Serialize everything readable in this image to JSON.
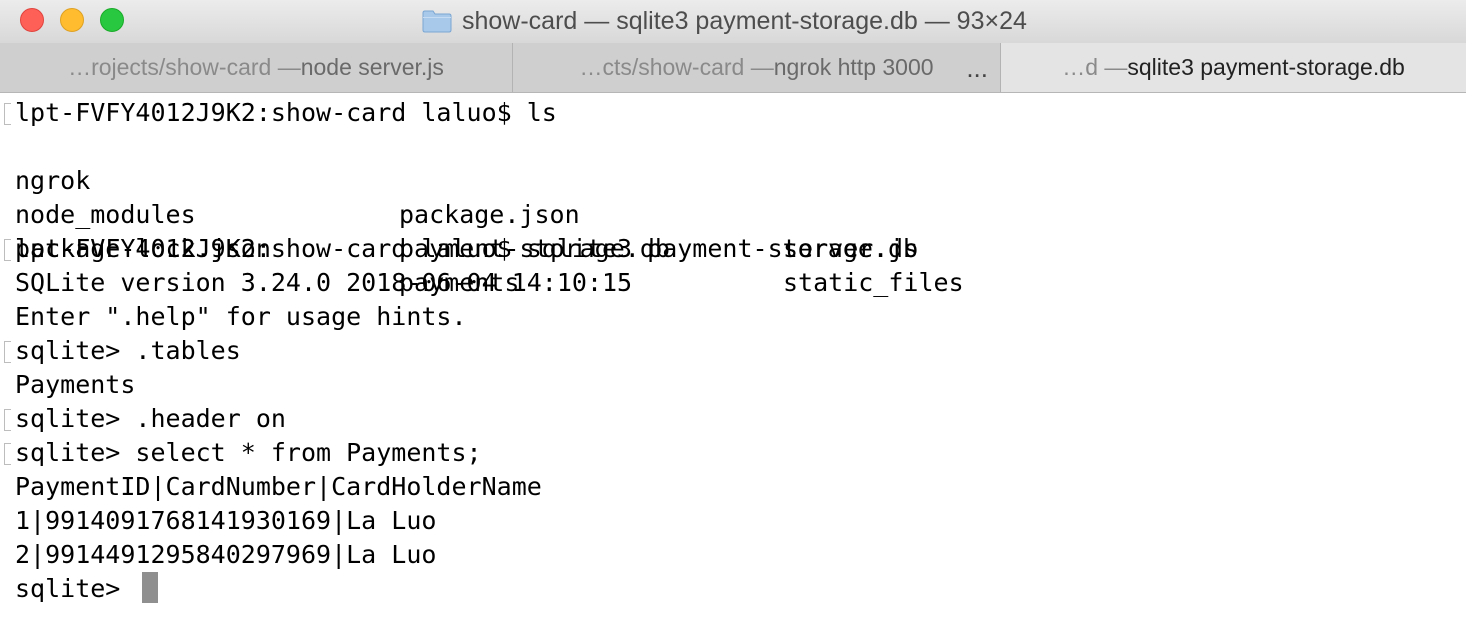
{
  "window": {
    "title": "show-card — sqlite3 payment-storage.db — 93×24"
  },
  "tabs": [
    {
      "prefix": "…rojects/show-card — ",
      "main": "node server.js"
    },
    {
      "prefix": "…cts/show-card — ",
      "main": "ngrok http 3000",
      "overflow": "..."
    },
    {
      "prefix": "…d — ",
      "main": "sqlite3 payment-storage.db"
    }
  ],
  "terminal": {
    "lines": [
      "lpt-FVFY4012J9K2:show-card laluo$ ls",
      "SQLite version 3.24.0 2018-06-04 14:10:15",
      "Enter \".help\" for usage hints.",
      "sqlite> .tables",
      "Payments",
      "sqlite> .header on",
      "sqlite> select * from Payments;",
      "PaymentID|CardNumber|CardHolderName",
      "1|9914091768141930169|La Luo",
      "2|9914491295840297969|La Luo",
      "sqlite> "
    ],
    "ls_output": [
      [
        "ngrok",
        "package.json",
        "server.js"
      ],
      [
        "node_modules",
        "payment-storage.db",
        "static_files"
      ],
      [
        "package-lock.json",
        "payments",
        ""
      ]
    ],
    "sqlite_cmd": "lpt-FVFY4012J9K2:show-card laluo$ sqlite3 payment-storage.db"
  },
  "colors": {
    "close": "#fe5f57",
    "minimize": "#febc2e",
    "maximize": "#28c840",
    "folder": "#a7c7e7",
    "cursor": "#8f8f8f"
  },
  "icons": {
    "close": "close-icon",
    "minimize": "minimize-icon",
    "maximize": "maximize-icon",
    "folder": "folder-icon"
  }
}
